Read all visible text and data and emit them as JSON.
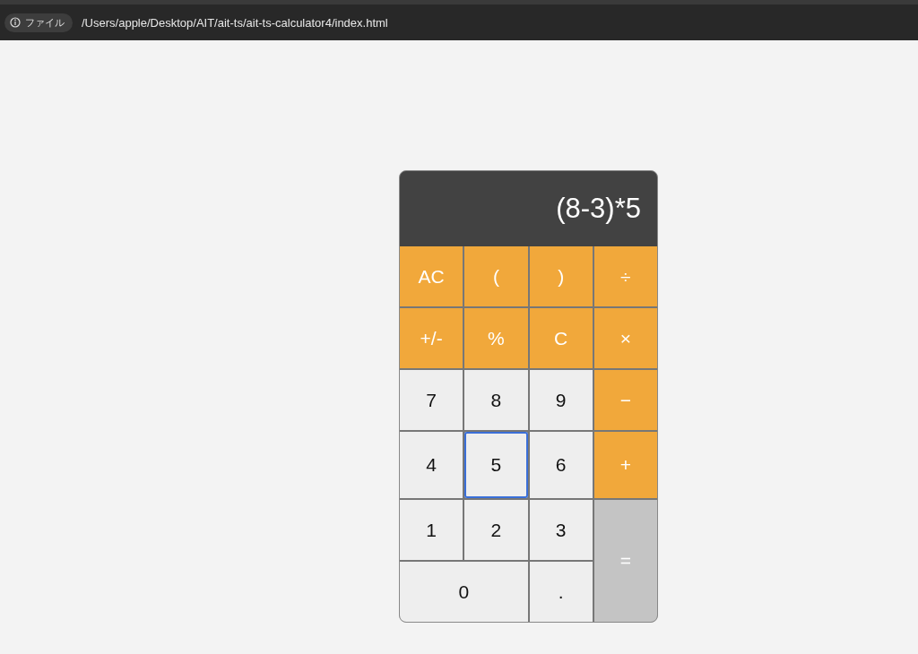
{
  "address_bar": {
    "scheme_label": "ファイル",
    "url": "/Users/apple/Desktop/AIT/ait-ts/ait-ts-calculator4/index.html"
  },
  "calculator": {
    "display": "(8-3)*5",
    "keys": [
      {
        "label": "AC",
        "kind": "operator",
        "wide": false,
        "tall": false,
        "focused": false
      },
      {
        "label": "(",
        "kind": "operator",
        "wide": false,
        "tall": false,
        "focused": false
      },
      {
        "label": ")",
        "kind": "operator",
        "wide": false,
        "tall": false,
        "focused": false
      },
      {
        "label": "÷",
        "kind": "operator",
        "wide": false,
        "tall": false,
        "focused": false
      },
      {
        "label": "+/-",
        "kind": "operator",
        "wide": false,
        "tall": false,
        "focused": false
      },
      {
        "label": "%",
        "kind": "operator",
        "wide": false,
        "tall": false,
        "focused": false
      },
      {
        "label": "C",
        "kind": "operator",
        "wide": false,
        "tall": false,
        "focused": false
      },
      {
        "label": "×",
        "kind": "operator",
        "wide": false,
        "tall": false,
        "focused": false
      },
      {
        "label": "7",
        "kind": "digit",
        "wide": false,
        "tall": false,
        "focused": false
      },
      {
        "label": "8",
        "kind": "digit",
        "wide": false,
        "tall": false,
        "focused": false
      },
      {
        "label": "9",
        "kind": "digit",
        "wide": false,
        "tall": false,
        "focused": false
      },
      {
        "label": "−",
        "kind": "operator",
        "wide": false,
        "tall": false,
        "focused": false
      },
      {
        "label": "4",
        "kind": "digit",
        "wide": false,
        "tall": false,
        "focused": false
      },
      {
        "label": "5",
        "kind": "digit",
        "wide": false,
        "tall": false,
        "focused": true
      },
      {
        "label": "6",
        "kind": "digit",
        "wide": false,
        "tall": false,
        "focused": false
      },
      {
        "label": "+",
        "kind": "operator",
        "wide": false,
        "tall": false,
        "focused": false
      },
      {
        "label": "1",
        "kind": "digit",
        "wide": false,
        "tall": false,
        "focused": false
      },
      {
        "label": "2",
        "kind": "digit",
        "wide": false,
        "tall": false,
        "focused": false
      },
      {
        "label": "3",
        "kind": "digit",
        "wide": false,
        "tall": false,
        "focused": false
      },
      {
        "label": "=",
        "kind": "equals",
        "wide": false,
        "tall": true,
        "focused": false
      },
      {
        "label": "0",
        "kind": "digit",
        "wide": true,
        "tall": false,
        "focused": false
      },
      {
        "label": ".",
        "kind": "digit",
        "wide": false,
        "tall": false,
        "focused": false
      }
    ]
  }
}
